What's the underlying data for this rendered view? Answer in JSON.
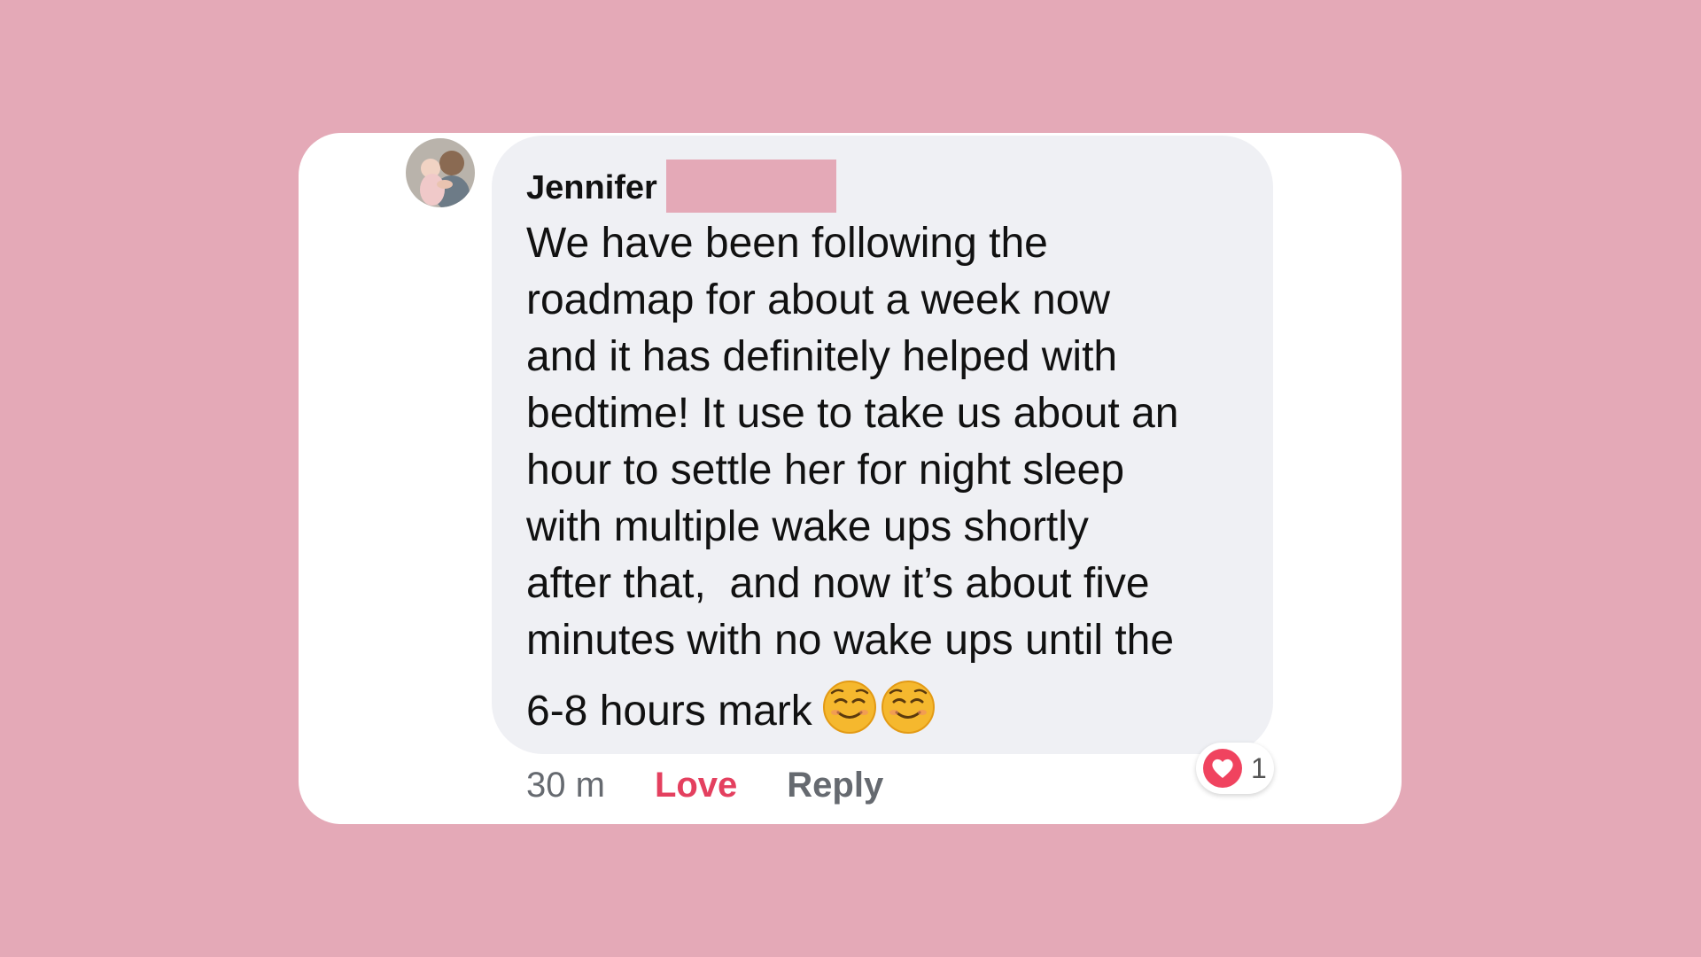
{
  "comment": {
    "author": "Jennifer",
    "lines": [
      "We have been following the",
      "roadmap for about a week now",
      "and it has definitely helped with",
      "bedtime! It use to take us about an",
      "hour to settle her for night sleep",
      "with multiple wake ups shortly",
      "after that,  and now it’s about five",
      "minutes with no wake ups until the"
    ],
    "last_line": "6-8 hours mark",
    "emojis": [
      "smiling-face-emoji",
      "smiling-face-emoji"
    ]
  },
  "actions": {
    "timestamp": "30 m",
    "love_label": "Love",
    "reply_label": "Reply"
  },
  "reactions": {
    "icon": "heart-icon",
    "count": "1"
  },
  "colors": {
    "background": "#e4a9b7",
    "bubble": "#eff0f4",
    "love": "#e4405f",
    "muted": "#666a70"
  }
}
